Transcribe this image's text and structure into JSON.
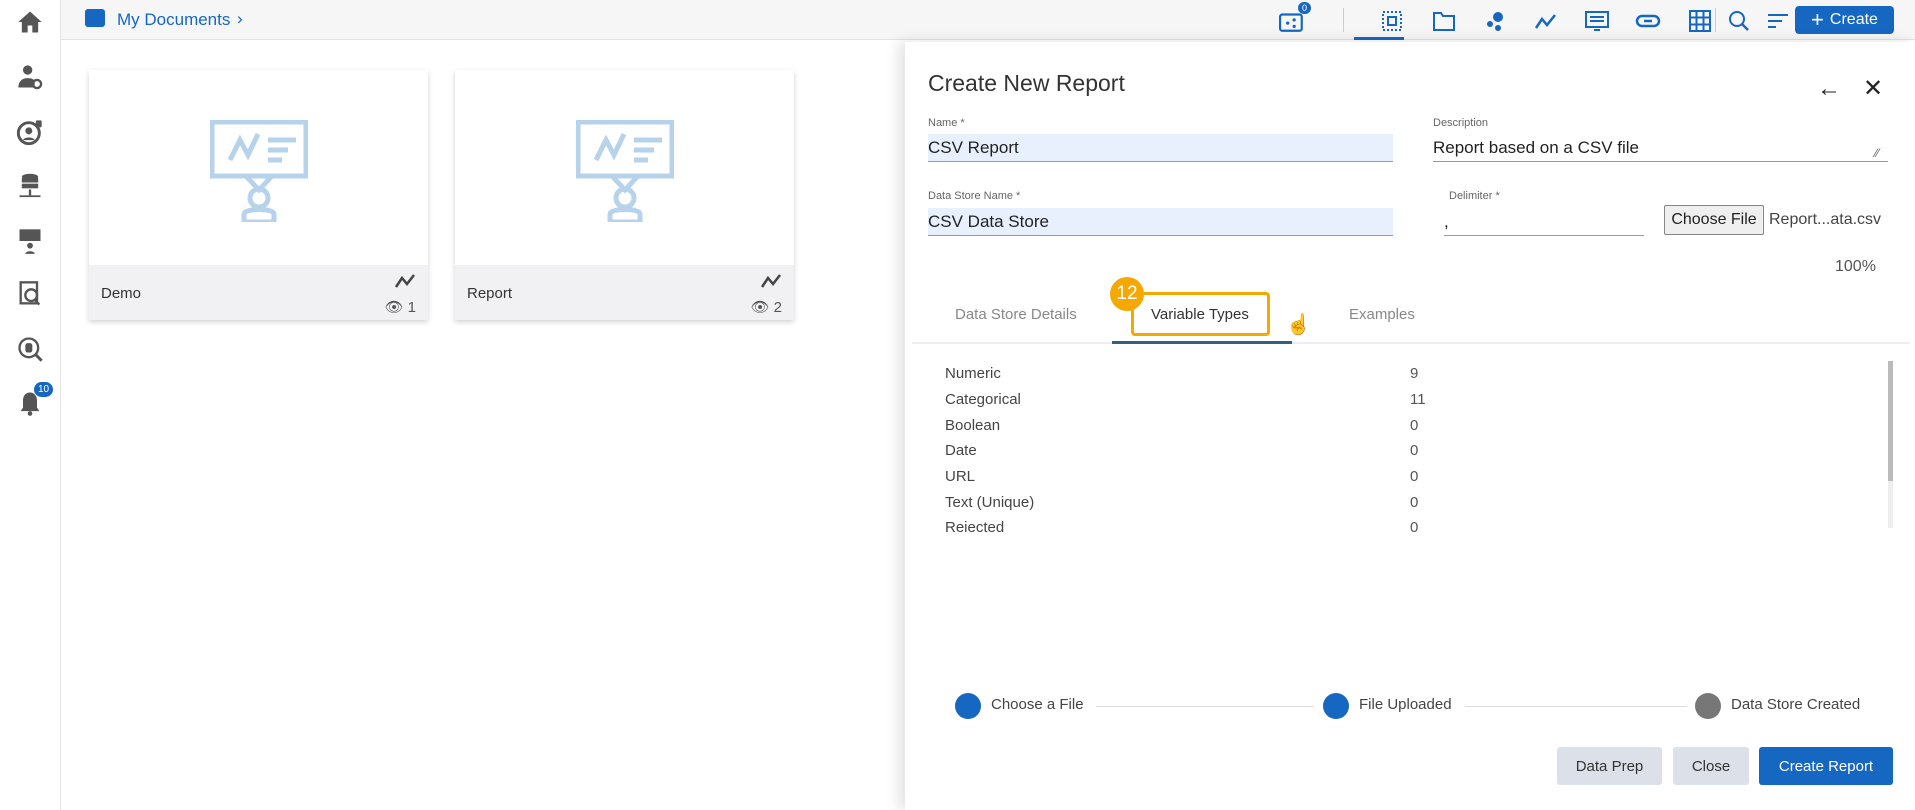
{
  "breadcrumb": {
    "label": "My Documents"
  },
  "toolbar": {
    "share_badge": "0",
    "create_label": "Create"
  },
  "sidebar": {
    "notification_badge": "10"
  },
  "cards": [
    {
      "name": "Demo",
      "views": "1"
    },
    {
      "name": "Report",
      "views": "2"
    }
  ],
  "panel": {
    "title": "Create New Report",
    "name_label": "Name *",
    "name_value": "CSV Report",
    "description_label": "Description",
    "description_value": "Report based on a CSV file",
    "datastore_label": "Data Store Name *",
    "datastore_value": "CSV Data Store",
    "delimiter_label": "Delimiter *",
    "delimiter_value": ",",
    "choose_file_label": "Choose File",
    "file_name": "Report...ata.csv",
    "progress": "100%",
    "tabs": [
      "Data Store Details",
      "Variable Types",
      "Examples"
    ],
    "step_badge": "12",
    "variables": [
      {
        "type": "Numeric",
        "count": "9"
      },
      {
        "type": "Categorical",
        "count": "11"
      },
      {
        "type": "Boolean",
        "count": "0"
      },
      {
        "type": "Date",
        "count": "0"
      },
      {
        "type": "URL",
        "count": "0"
      },
      {
        "type": "Text (Unique)",
        "count": "0"
      },
      {
        "type": "Rejected",
        "count": "0"
      }
    ],
    "steps": [
      "Choose a File",
      "File Uploaded",
      "Data Store Created"
    ],
    "buttons": {
      "data_prep": "Data Prep",
      "close": "Close",
      "create_report": "Create Report"
    }
  },
  "colors": {
    "accent": "#1667c1",
    "highlight": "#f5a800"
  }
}
